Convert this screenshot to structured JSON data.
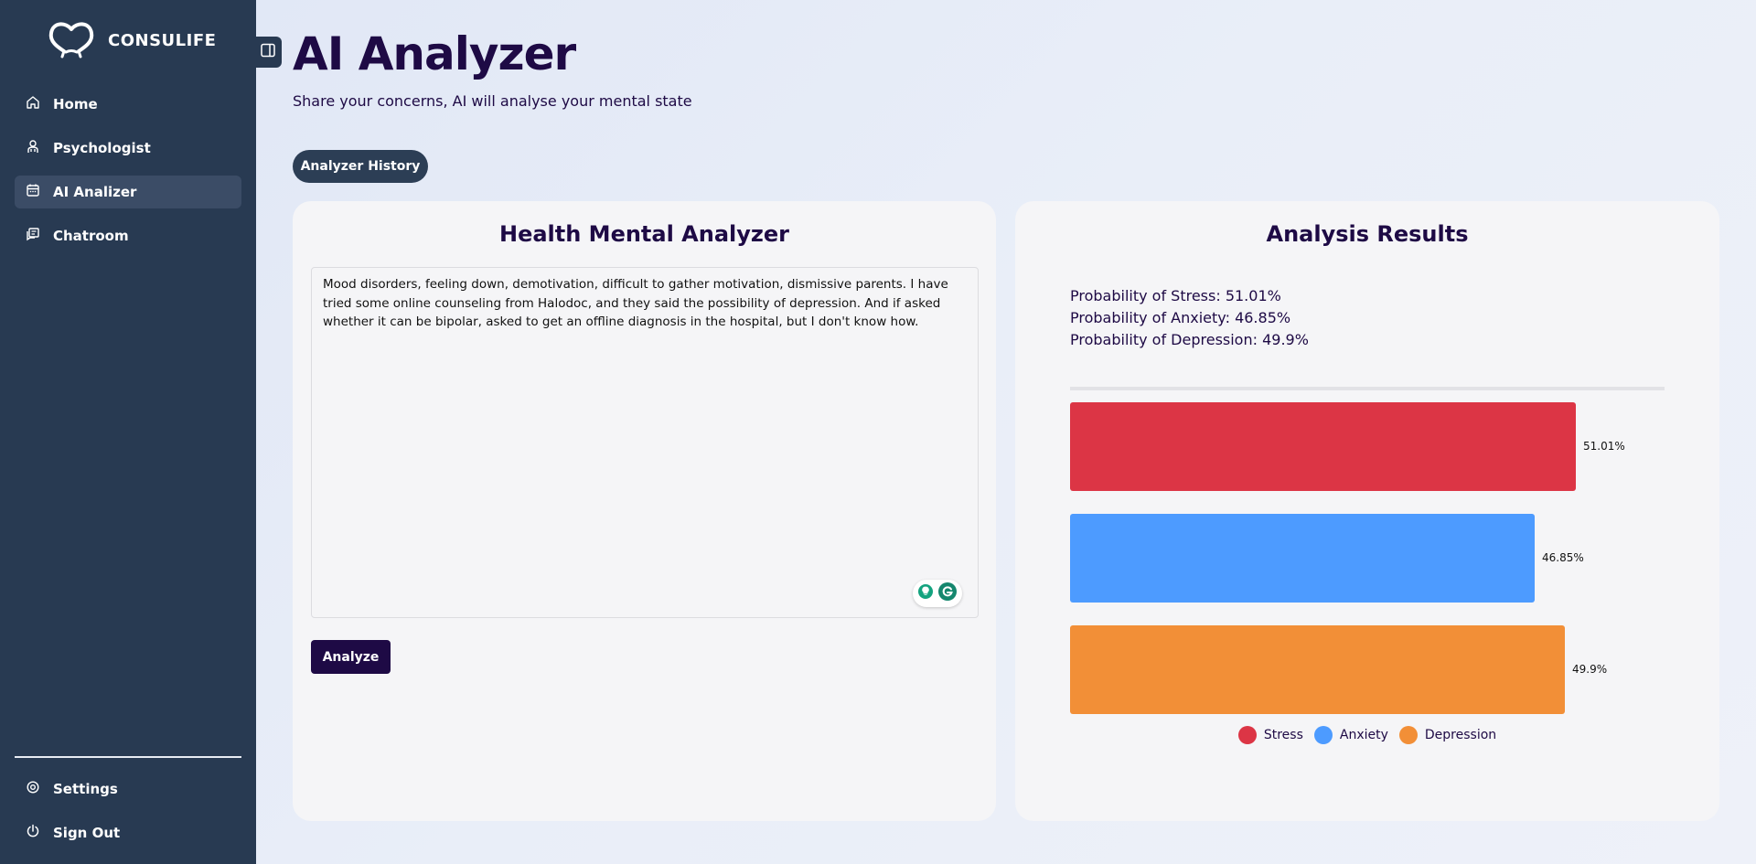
{
  "app": {
    "name": "CONSULIFE"
  },
  "sidebar": {
    "items": [
      {
        "label": "Home",
        "icon": "home-icon",
        "active": false
      },
      {
        "label": "Psychologist",
        "icon": "psychologist-icon",
        "active": false
      },
      {
        "label": "AI Analizer",
        "icon": "calendar-icon",
        "active": true
      },
      {
        "label": "Chatroom",
        "icon": "chat-icon",
        "active": false
      }
    ],
    "bottom_items": [
      {
        "label": "Settings",
        "icon": "settings-icon"
      },
      {
        "label": "Sign Out",
        "icon": "power-icon"
      }
    ]
  },
  "header": {
    "title": "AI Analyzer",
    "subtitle": "Share your concerns, AI will analyse your mental state"
  },
  "history_button": "Analyzer History",
  "analyzer": {
    "title": "Health Mental Analyzer",
    "text": "Mood disorders, feeling down, demotivation, difficult to gather motivation, dismissive parents. I have tried some online counseling from Halodoc, and they said the possibility of depression. And if asked whether it can be bipolar, asked to get an offline diagnosis in the hospital, but I don't know how.",
    "analyze_button": "Analyze"
  },
  "results": {
    "title": "Analysis Results",
    "lines": [
      "Probability of Stress: 51.01%",
      "Probability of Anxiety: 46.85%",
      "Probability of Depression: 49.9%"
    ]
  },
  "colors": {
    "stress": "#dc3545",
    "anxiety": "#4d9bff",
    "depression": "#f28f37",
    "sidebar": "#283a52",
    "primary": "#1e0a45"
  },
  "chart_data": {
    "type": "bar",
    "orientation": "horizontal",
    "categories": [
      "Stress",
      "Anxiety",
      "Depression"
    ],
    "values": [
      51.01,
      46.85,
      49.9
    ],
    "value_labels": [
      "51.01%",
      "46.85%",
      "49.9%"
    ],
    "xlim": [
      0,
      60
    ],
    "legend": [
      "Stress",
      "Anxiety",
      "Depression"
    ],
    "legend_position": "bottom"
  }
}
